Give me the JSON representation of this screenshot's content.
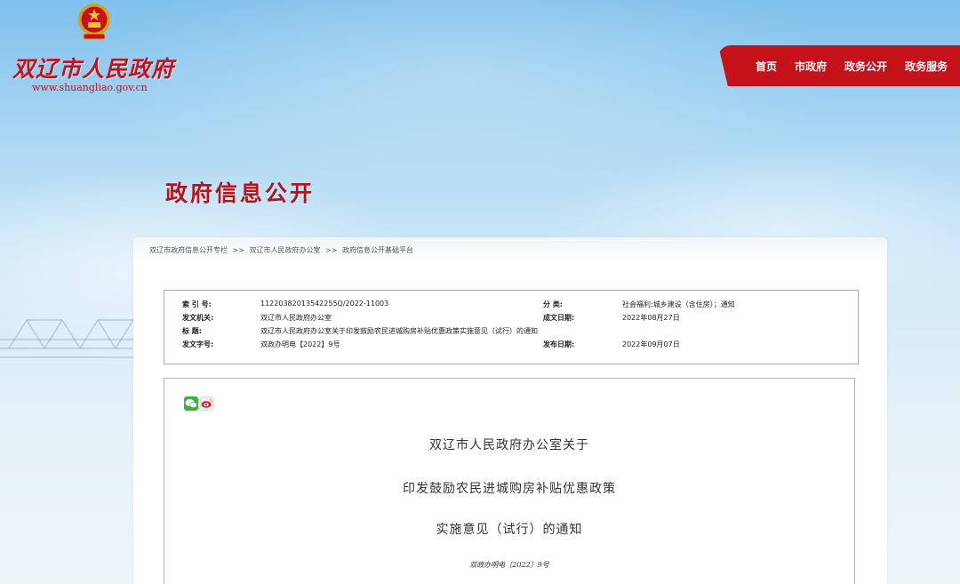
{
  "header": {
    "site_name": "双辽市人民政府",
    "site_url": "www.shuangliao.gov.cn",
    "nav": [
      "首页",
      "市政府",
      "政务公开",
      "政务服务"
    ]
  },
  "section_title": "政府信息公开",
  "breadcrumb": [
    "双辽市政府信息公开专栏",
    "双辽市人民政府办公室",
    "政府信息公开基础平台"
  ],
  "breadcrumb_sep": ">>",
  "meta": {
    "index_label": "索 引 号:",
    "index_value": "11220382013542255Q/2022-11003",
    "category_label": "分    类:",
    "category_value": "社会福利;城乡建设（含住房）；通知",
    "issuer_label": "发文机关:",
    "issuer_value": "双辽市人民政府办公室",
    "created_label": "成文日期:",
    "created_value": "2022年08月27日",
    "title_label": "标    题:",
    "title_value": "双辽市人民政府办公室关于印发鼓励农民进城购房补贴优惠政策实施意见（试行）的通知",
    "docno_label": "发文字号:",
    "docno_value": "双政办明电【2022】9号",
    "published_label": "发布日期:",
    "published_value": "2022年09月07日"
  },
  "article": {
    "title_line1": "双辽市人民政府办公室关于",
    "title_line2": "印发鼓励农民进城购房补贴优惠政策",
    "title_line3": "实施意见（试行）的通知",
    "doc_number": "双政办明电〔2022〕9号"
  },
  "colors": {
    "brand_red": "#c5121a",
    "nav_text": "#ffffff"
  },
  "icons": [
    "national-emblem-icon",
    "wechat-icon",
    "weibo-icon"
  ]
}
